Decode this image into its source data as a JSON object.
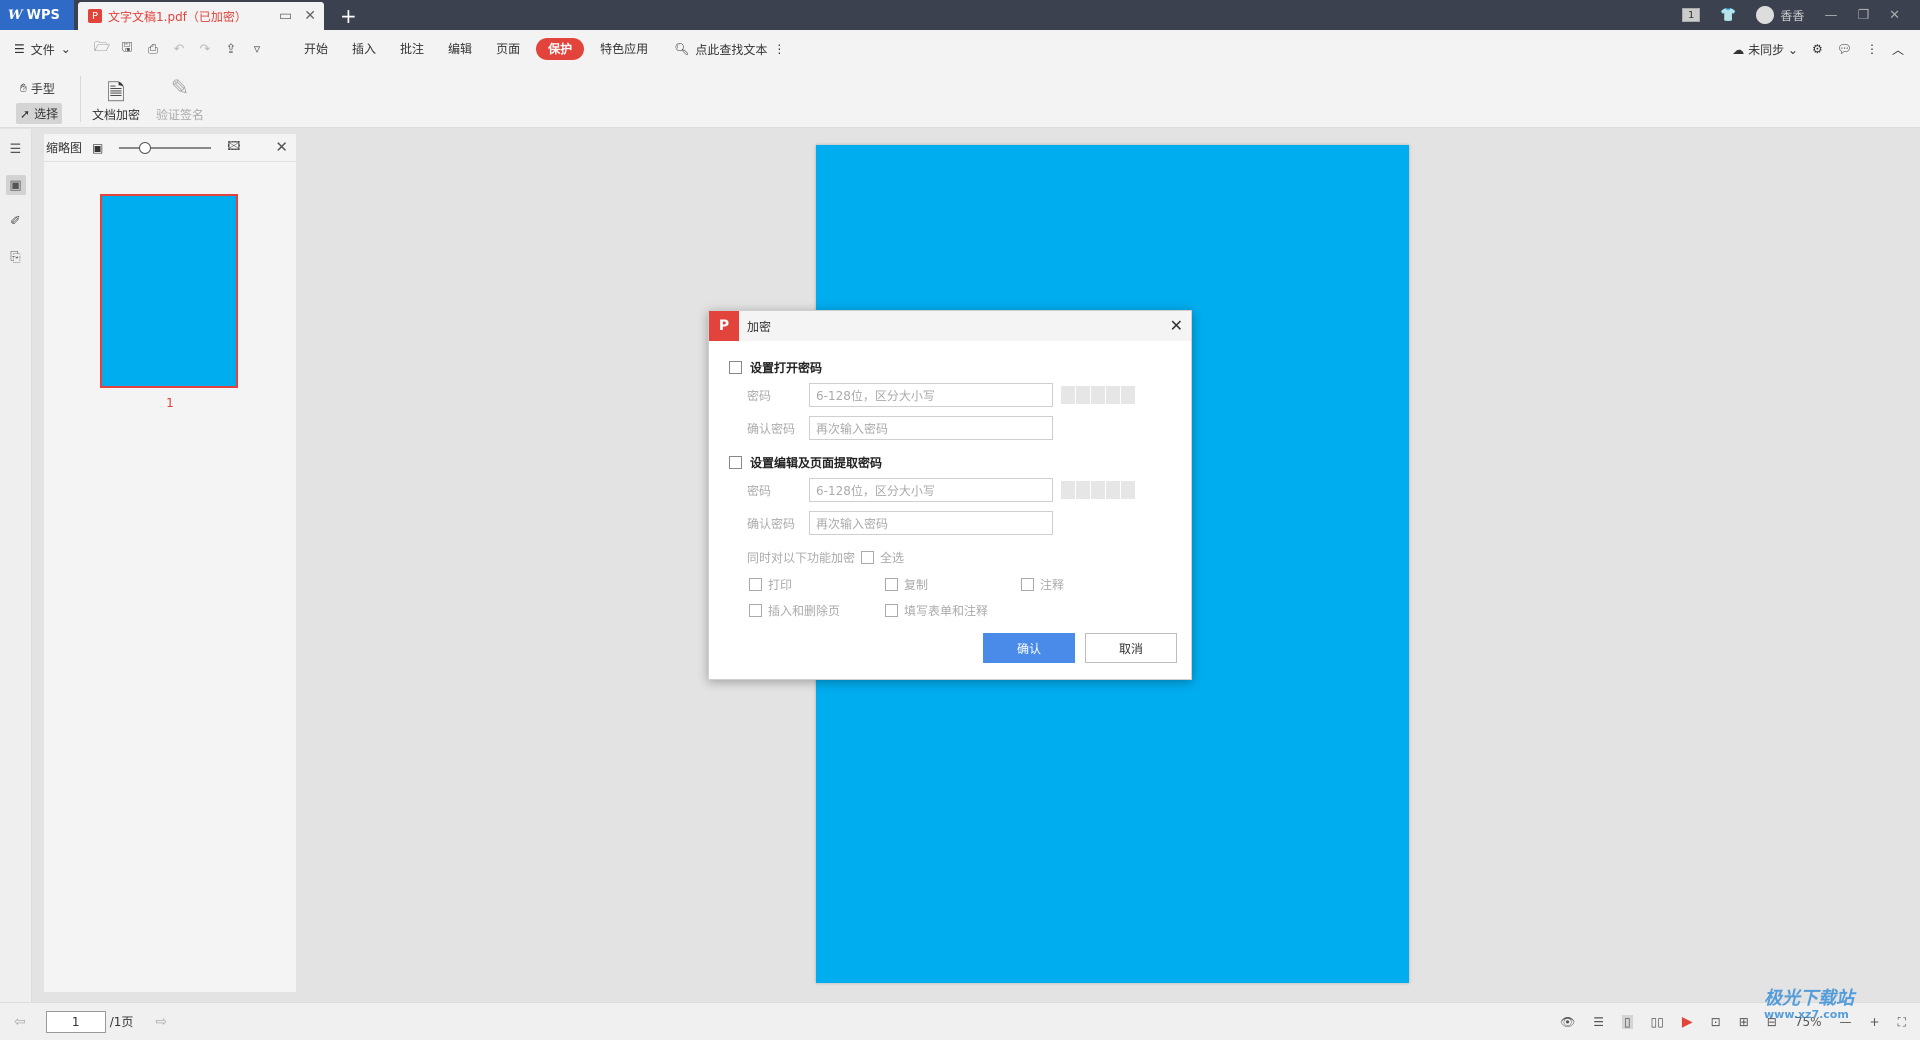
{
  "titlebar": {
    "app_name": "WPS",
    "doc_tab_title": "文字文稿1.pdf（已加密）",
    "user_name": "香香",
    "page_indicator": "1"
  },
  "menubar": {
    "file_label": "文件",
    "tabs": [
      "开始",
      "插入",
      "批注",
      "编辑",
      "页面",
      "保护",
      "特色应用"
    ],
    "active_tab": "保护",
    "search_label": "点此查找文本",
    "sync_label": "未同步"
  },
  "ribbon": {
    "hand_tool": "手型",
    "select_tool": "选择",
    "encrypt_doc": "文档加密",
    "verify_sign": "验证签名"
  },
  "thumbnails": {
    "title": "缩略图",
    "page_number": "1"
  },
  "dialog": {
    "title": "加密",
    "section_open": "设置打开密码",
    "password_label": "密码",
    "password_placeholder": "6-128位，区分大小写",
    "confirm_label": "确认密码",
    "confirm_placeholder": "再次输入密码",
    "section_edit": "设置编辑及页面提取密码",
    "also_encrypt_label": "同时对以下功能加密",
    "select_all": "全选",
    "options": [
      "打印",
      "复制",
      "注释",
      "插入和删除页",
      "填写表单和注释"
    ],
    "ok_button": "确认",
    "cancel_button": "取消"
  },
  "statusbar": {
    "current_page": "1",
    "total_pages": "/1页",
    "zoom": "75%"
  },
  "watermark": {
    "text": "极光下载站",
    "url": "www.xz7.com"
  },
  "colors": {
    "accent": "#e2433b",
    "page_fill": "#00adef",
    "primary_button": "#4a8ae8"
  }
}
